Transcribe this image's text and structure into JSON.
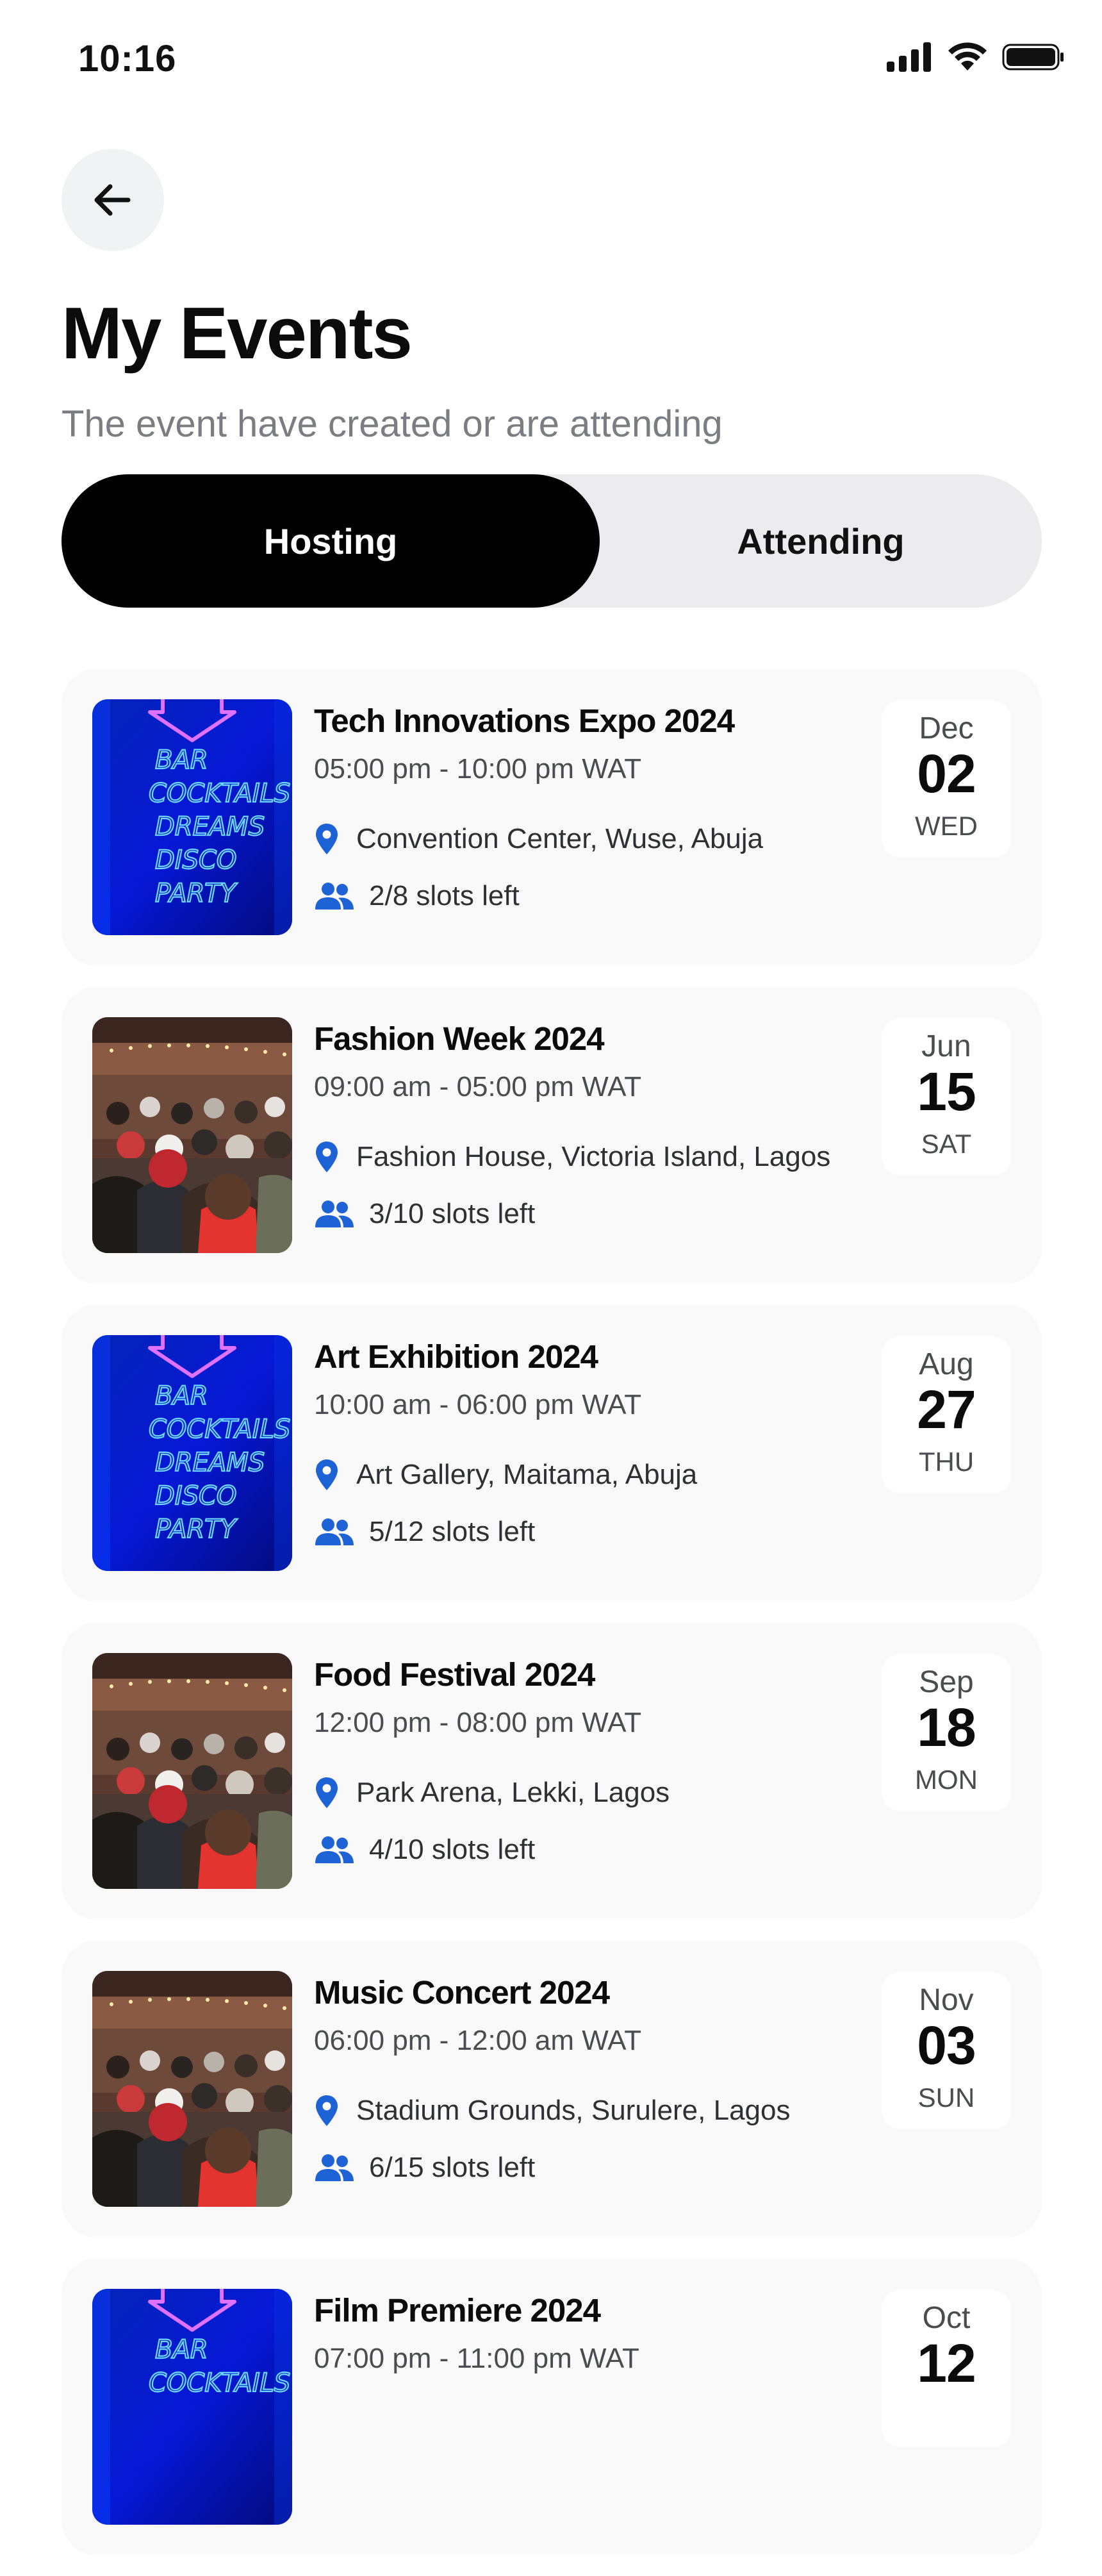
{
  "status_bar": {
    "time": "10:16"
  },
  "header": {
    "back_icon": "arrow-left-icon",
    "title": "My Events",
    "subtitle": "The event have created or are attending"
  },
  "tabs": [
    {
      "label": "Hosting",
      "active": true
    },
    {
      "label": "Attending",
      "active": false
    }
  ],
  "colors": {
    "accent": "#1e63d6",
    "active_tab_bg": "#000000",
    "inactive_tab_bg": "#ececee"
  },
  "events": [
    {
      "title": "Tech Innovations Expo 2024",
      "time": "05:00 pm - 10:00 pm WAT",
      "location": "Convention Center, Wuse, Abuja",
      "slots": "2/8 slots left",
      "month": "Dec",
      "day": "02",
      "weekday": "WED",
      "image": "neon-sign",
      "neon_lines": [
        "BAR",
        "COCKTAILS",
        "DREAMS",
        "DISCO",
        "PARTY"
      ]
    },
    {
      "title": "Fashion Week 2024",
      "time": "09:00 am - 05:00 pm WAT",
      "location": "Fashion House, Victoria Island, Lagos",
      "slots": "3/10 slots left",
      "month": "Jun",
      "day": "15",
      "weekday": "SAT",
      "image": "crowd-photo"
    },
    {
      "title": "Art Exhibition 2024",
      "time": "10:00 am - 06:00 pm WAT",
      "location": "Art Gallery, Maitama, Abuja",
      "slots": "5/12 slots left",
      "month": "Aug",
      "day": "27",
      "weekday": "THU",
      "image": "neon-sign",
      "neon_lines": [
        "BAR",
        "COCKTAILS",
        "DREAMS",
        "DISCO",
        "PARTY"
      ]
    },
    {
      "title": "Food Festival 2024",
      "time": "12:00 pm - 08:00 pm WAT",
      "location": "Park Arena, Lekki, Lagos",
      "slots": "4/10 slots left",
      "month": "Sep",
      "day": "18",
      "weekday": "MON",
      "image": "crowd-photo"
    },
    {
      "title": "Music Concert 2024",
      "time": "06:00 pm - 12:00 am WAT",
      "location": "Stadium Grounds, Surulere, Lagos",
      "slots": "6/15 slots left",
      "month": "Nov",
      "day": "03",
      "weekday": "SUN",
      "image": "crowd-photo"
    },
    {
      "title": "Film Premiere 2024",
      "time": "07:00 pm - 11:00 pm WAT",
      "location": "",
      "slots": "",
      "month": "Oct",
      "day": "12",
      "weekday": "",
      "image": "neon-sign",
      "neon_lines": [
        "BAR",
        "COCKTAILS"
      ]
    }
  ]
}
